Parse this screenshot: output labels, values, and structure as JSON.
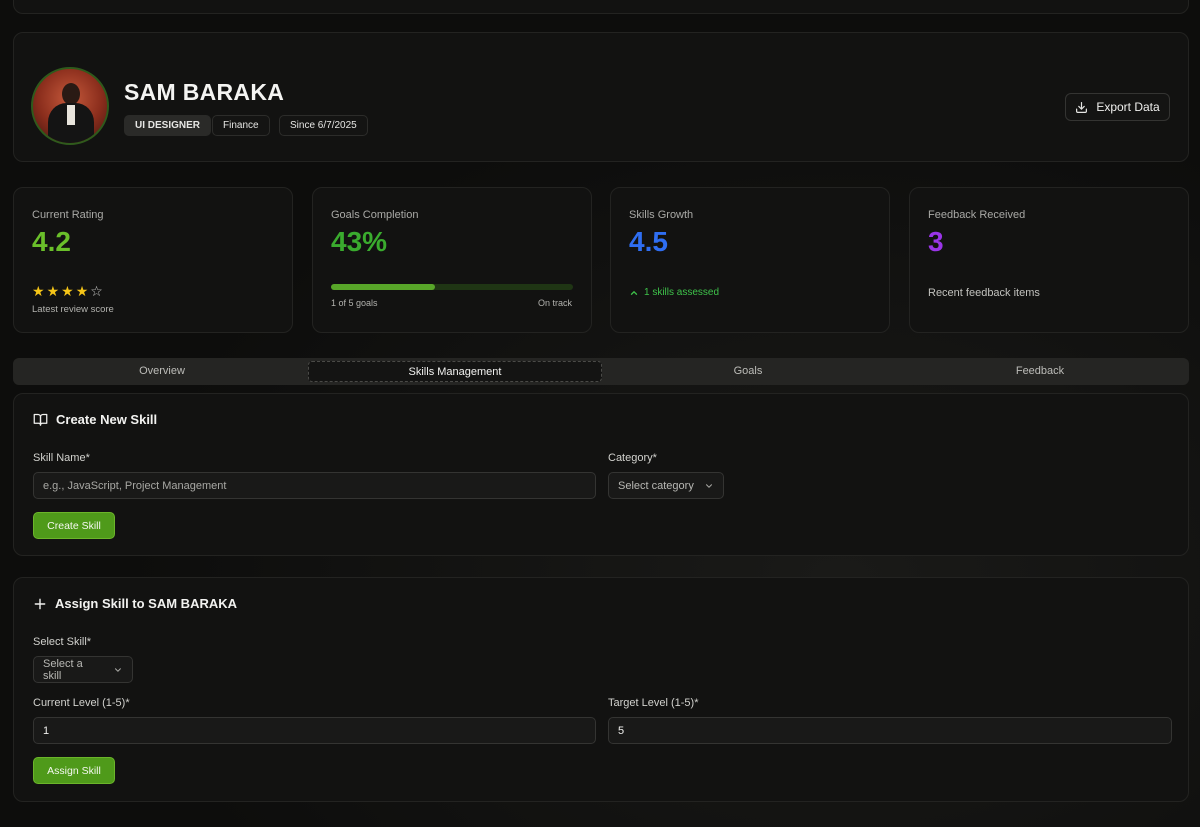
{
  "profile": {
    "name": "SAM BARAKA",
    "role_badge": "UI DESIGNER",
    "department_badge": "Finance",
    "since_badge": "Since 6/7/2025",
    "export_label": "Export Data"
  },
  "stats": {
    "rating": {
      "label": "Current Rating",
      "value": "4.2",
      "color": "#6abf2a",
      "stars_filled": 4,
      "stars_total": 5,
      "sub": "Latest review score"
    },
    "goals": {
      "label": "Goals Completion",
      "value": "43%",
      "color": "#3aab2e",
      "progress": 0.43,
      "sub_left": "1 of 5 goals",
      "sub_right": "On track"
    },
    "skills": {
      "label": "Skills Growth",
      "value": "4.5",
      "color": "#2f6ef2",
      "sub": "1 skills assessed"
    },
    "feedback": {
      "label": "Feedback Received",
      "value": "3",
      "color": "#9a35e8",
      "sub": "Recent feedback items"
    }
  },
  "tabs": [
    {
      "label": "Overview"
    },
    {
      "label": "Skills Management",
      "active": true
    },
    {
      "label": "Goals"
    },
    {
      "label": "Feedback"
    }
  ],
  "create_skill": {
    "title": "Create New Skill",
    "name_label": "Skill Name*",
    "name_placeholder": "e.g., JavaScript, Project Management",
    "category_label": "Category*",
    "category_value": "Select category",
    "button": "Create Skill"
  },
  "assign_skill": {
    "title": "Assign Skill to SAM BARAKA",
    "select_label": "Select Skill*",
    "select_value": "Select a skill",
    "current_label": "Current Level (1-5)*",
    "current_value": "1",
    "target_label": "Target Level (1-5)*",
    "target_value": "5",
    "button": "Assign Skill"
  }
}
